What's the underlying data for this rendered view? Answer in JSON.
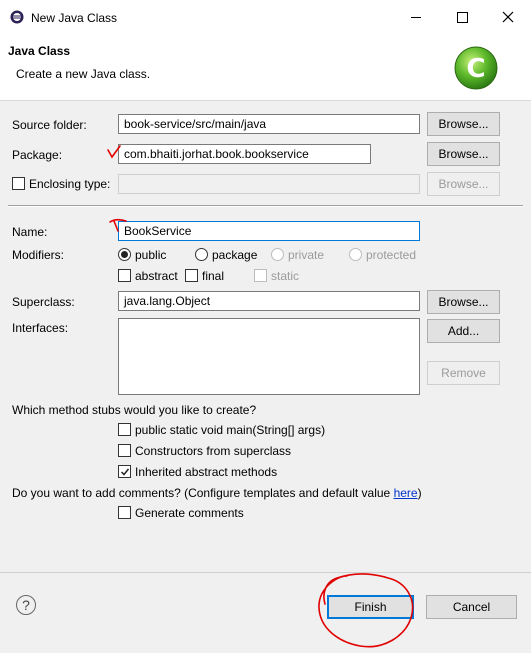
{
  "window": {
    "title": "New Java Class"
  },
  "header": {
    "title": "Java Class",
    "description": "Create a new Java class."
  },
  "form": {
    "source_folder": {
      "label": "Source folder:",
      "value": "book-service/src/main/java",
      "button": "Browse..."
    },
    "package": {
      "label": "Package:",
      "value": "com.bhaiti.jorhat.book.bookservice",
      "button": "Browse..."
    },
    "enclosing_type": {
      "label": "Enclosing type:",
      "value": "",
      "button": "Browse..."
    },
    "name": {
      "label": "Name:",
      "value": "BookService"
    },
    "modifiers": {
      "label": "Modifiers:",
      "public": "public",
      "package": "package",
      "private": "private",
      "protected": "protected",
      "abstract": "abstract",
      "final": "final",
      "static": "static",
      "selected": "public"
    },
    "superclass": {
      "label": "Superclass:",
      "value": "java.lang.Object",
      "button": "Browse..."
    },
    "interfaces": {
      "label": "Interfaces:",
      "add_button": "Add...",
      "remove_button": "Remove"
    },
    "stubs": {
      "question": "Which method stubs would you like to create?",
      "main": "public static void main(String[] args)",
      "constructors": "Constructors from superclass",
      "inherited": "Inherited abstract methods",
      "checked": [
        "inherited"
      ]
    },
    "comments": {
      "question": "Do you want to add comments? (Configure templates and default value ",
      "link": "here",
      "question_end": ")",
      "generate": "Generate comments"
    }
  },
  "footer": {
    "help": "?",
    "finish": "Finish",
    "cancel": "Cancel"
  },
  "colors": {
    "accent": "#0078d7",
    "annotation": "#e00000",
    "link": "#0033cc"
  }
}
